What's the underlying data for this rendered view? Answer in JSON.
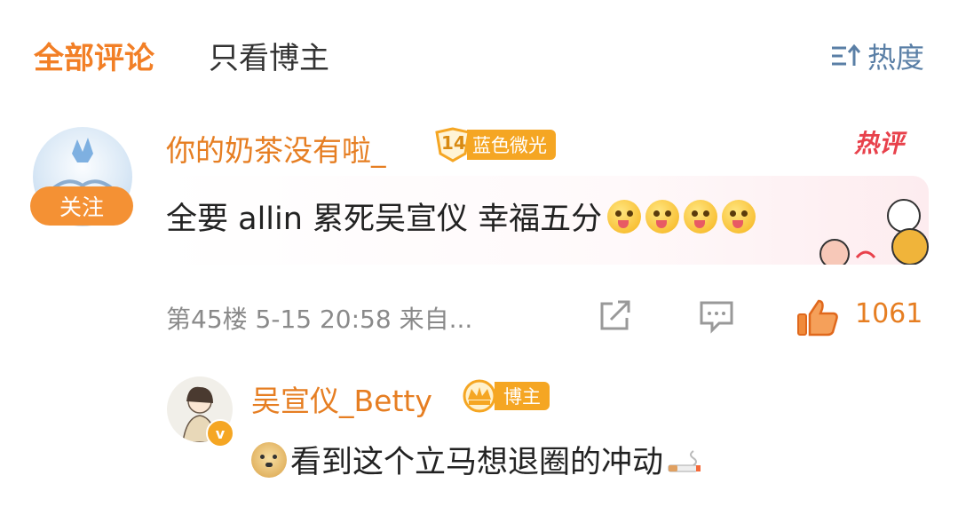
{
  "tabs": {
    "all": "全部评论",
    "author_only": "只看博主",
    "sort_label": "热度",
    "sort_icon": "sort-icon"
  },
  "comment": {
    "follow_label": "关注",
    "username": "你的奶茶没有啦_",
    "badge_level": "14",
    "badge_text": "蓝色微光",
    "hot_tag": "热评",
    "text": "全要 allin 累死吴宣仪  幸福五分",
    "emojis": [
      "tongue-emoji",
      "tongue-emoji",
      "tongue-emoji",
      "tongue-emoji"
    ],
    "floor": "第45楼",
    "time": "5-15 20:58",
    "source": "来自...",
    "like_count": "1061"
  },
  "reply": {
    "username": "吴宣仪_Betty",
    "badge_text": "博主",
    "text": "看到这个立马想退圈的冲动",
    "leading_emoji": "doge-emoji",
    "trailing_emoji": "cigarette-emoji"
  },
  "colors": {
    "accent": "#f27f26",
    "username": "#e67e22",
    "hot": "#e8414b",
    "badge": "#f5a623",
    "sort": "#5a7fa6"
  }
}
